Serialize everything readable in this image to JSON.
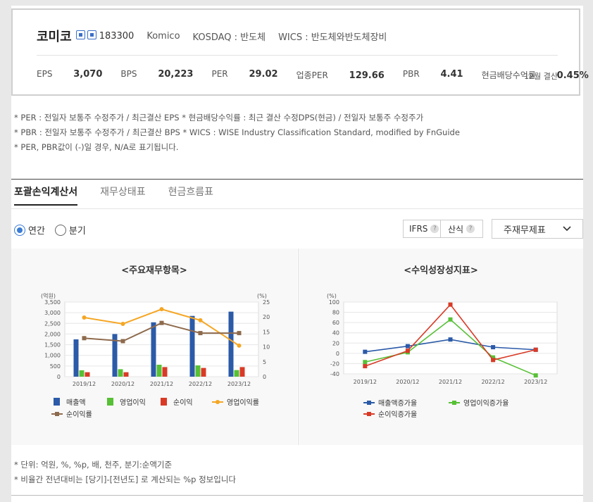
{
  "company": {
    "name": "코미코",
    "code": "183300",
    "english_name": "Komico",
    "market": "KOSDAQ : 반도체",
    "wics": "WICS : 반도체와반도체장비",
    "icons": [
      "home-icon",
      "building-icon"
    ]
  },
  "indicators": [
    {
      "label": "EPS",
      "value": "3,070"
    },
    {
      "label": "BPS",
      "value": "20,223"
    },
    {
      "label": "PER",
      "value": "29.02"
    },
    {
      "label": "업종PER",
      "value": "129.66"
    },
    {
      "label": "PBR",
      "value": "4.41"
    },
    {
      "label": "현금배당수익률",
      "value": "0.45%"
    }
  ],
  "settlement": "12월 결산",
  "notes": [
    "* PER : 전일자 보통주 수정주가 / 최근결산 EPS * 현금배당수익률 : 최근 결산 수정DPS(현금) / 전일자 보통주 수정주가",
    "* PBR : 전일자 보통주 수정주가 / 최근결산 BPS * WICS : WISE Industry Classification Standard, modified by FnGuide",
    "* PER, PBR값이 (-)일 경우, N/A로 표기됩니다."
  ],
  "tabs": [
    "포괄손익계산서",
    "재무상태표",
    "현금흐름표"
  ],
  "period": {
    "options": [
      "연간",
      "분기"
    ],
    "selected": "연간"
  },
  "controls": {
    "ifrs": "IFRS",
    "calc": "산식",
    "help": "?",
    "dropdown": "주재무제표"
  },
  "colors": {
    "revenue": "#2b5aa8",
    "op_income": "#57c035",
    "net_income": "#d93a26",
    "op_margin": "#f5a623",
    "net_margin": "#8e6a4c",
    "accent": "#3a7bd5"
  },
  "chart_data": [
    {
      "type": "bar",
      "title": "<주요재무항목>",
      "unit_left": "(억원)",
      "unit_right": "(%)",
      "categories": [
        "2019/12",
        "2020/12",
        "2021/12",
        "2022/12",
        "2023/12"
      ],
      "ylim": [
        0,
        3500
      ],
      "y2lim": [
        0,
        25
      ],
      "yticks": [
        "0",
        "500",
        "1,000",
        "1,500",
        "2,000",
        "2,500",
        "3,000",
        "3,500"
      ],
      "y2ticks": [
        "0",
        "5",
        "10",
        "15",
        "20",
        "25"
      ],
      "series": [
        {
          "name": "매출액",
          "type": "bar",
          "axis": "left",
          "values": [
            1750,
            2000,
            2550,
            2850,
            3050
          ]
        },
        {
          "name": "영업이익",
          "type": "bar",
          "axis": "left",
          "values": [
            300,
            350,
            560,
            530,
            310
          ]
        },
        {
          "name": "순이익",
          "type": "bar",
          "axis": "left",
          "values": [
            210,
            210,
            450,
            410,
            450
          ]
        },
        {
          "name": "영업이익률",
          "type": "line",
          "axis": "right",
          "values": [
            19.8,
            17.7,
            22.6,
            18.9,
            10.4
          ]
        },
        {
          "name": "순이익률",
          "type": "line",
          "axis": "right",
          "values": [
            12.9,
            11.9,
            18.0,
            14.6,
            14.6
          ]
        }
      ],
      "grid": true,
      "legend": "bottom"
    },
    {
      "type": "line",
      "title": "<수익성장성지표>",
      "unit_left": "(%)",
      "categories": [
        "2019/12",
        "2020/12",
        "2021/12",
        "2022/12",
        "2023/12"
      ],
      "ylim": [
        -40,
        100
      ],
      "yticks": [
        "-40",
        "-20",
        "0",
        "20",
        "40",
        "60",
        "80",
        "100"
      ],
      "series": [
        {
          "name": "매출액증가율",
          "values": [
            3,
            14,
            27,
            12,
            7
          ]
        },
        {
          "name": "영업이익증가율",
          "values": [
            -17,
            2,
            66,
            -8,
            -43
          ]
        },
        {
          "name": "순이익증가율",
          "values": [
            -25,
            5,
            95,
            -13,
            7
          ]
        }
      ],
      "grid": true,
      "legend": "bottom"
    }
  ],
  "footnotes": [
    "* 단위: 억원, %, %p, 배, 천주, 분기:순액기준",
    "* 비율간 전년대비는 [당기]-[전년도] 로 계산되는 %p 정보입니다"
  ]
}
